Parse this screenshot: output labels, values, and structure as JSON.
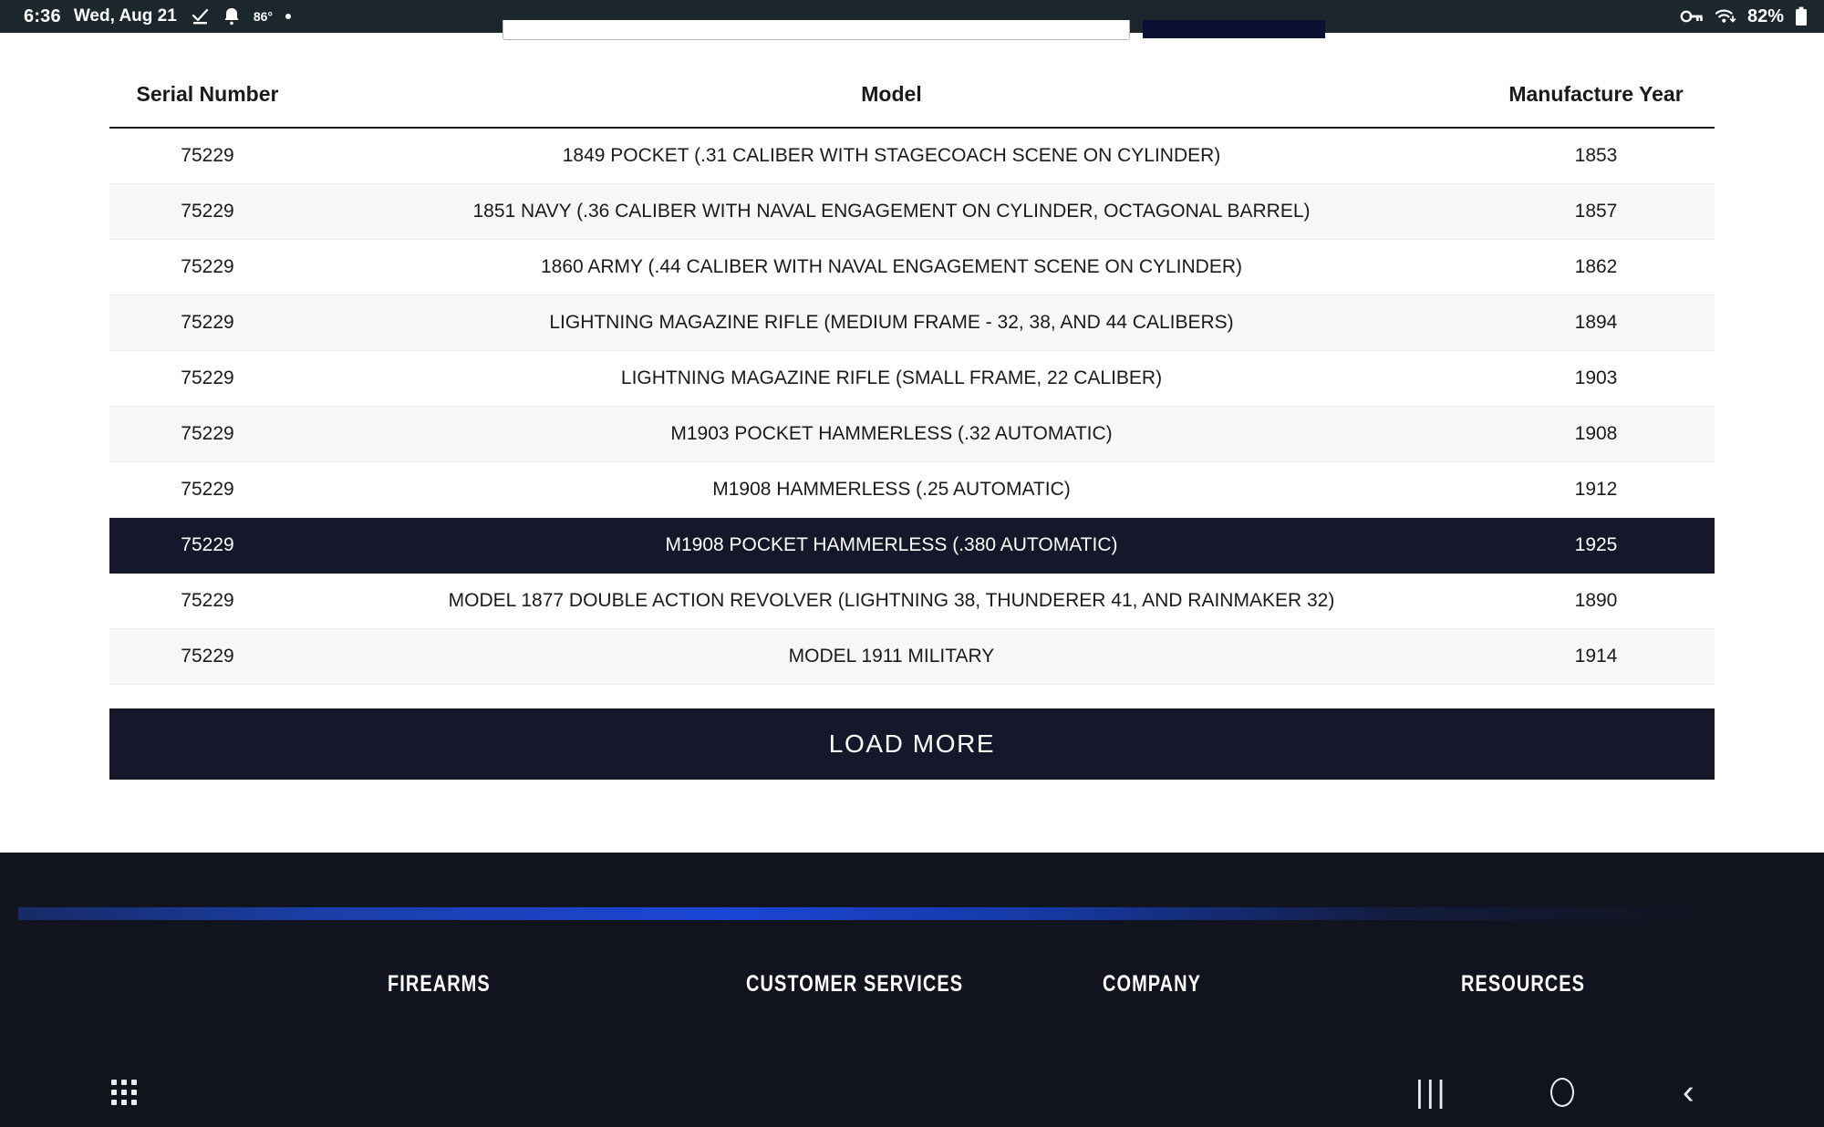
{
  "status_bar": {
    "time": "6:36",
    "date": "Wed, Aug 21",
    "temperature": "86",
    "degree": "°",
    "battery_percent": "82%",
    "icons": [
      "checkmark-underline-icon",
      "bell-icon",
      "vpn-key-icon",
      "wifi-icon",
      "battery-icon"
    ]
  },
  "table": {
    "columns": [
      "Serial Number",
      "Model",
      "Manufacture Year"
    ],
    "rows": [
      {
        "serial": "75229",
        "model": "1849 POCKET (.31 CALIBER WITH STAGECOACH SCENE ON CYLINDER)",
        "year": "1853"
      },
      {
        "serial": "75229",
        "model": "1851 NAVY (.36 CALIBER WITH NAVAL ENGAGEMENT ON CYLINDER, OCTAGONAL BARREL)",
        "year": "1857"
      },
      {
        "serial": "75229",
        "model": "1860 ARMY (.44 CALIBER WITH NAVAL ENGAGEMENT SCENE ON CYLINDER)",
        "year": "1862"
      },
      {
        "serial": "75229",
        "model": "LIGHTNING MAGAZINE RIFLE (MEDIUM FRAME - 32, 38, AND 44 CALIBERS)",
        "year": "1894"
      },
      {
        "serial": "75229",
        "model": "LIGHTNING MAGAZINE RIFLE (SMALL FRAME, 22 CALIBER)",
        "year": "1903"
      },
      {
        "serial": "75229",
        "model": "M1903 POCKET HAMMERLESS (.32 AUTOMATIC)",
        "year": "1908"
      },
      {
        "serial": "75229",
        "model": "M1908 HAMMERLESS (.25 AUTOMATIC)",
        "year": "1912"
      },
      {
        "serial": "75229",
        "model": "M1908 POCKET HAMMERLESS (.380 AUTOMATIC)",
        "year": "1925"
      },
      {
        "serial": "75229",
        "model": "MODEL 1877 DOUBLE ACTION REVOLVER (LIGHTNING 38, THUNDERER 41, AND RAINMAKER 32)",
        "year": "1890"
      },
      {
        "serial": "75229",
        "model": "MODEL 1911 MILITARY",
        "year": "1914"
      }
    ],
    "selected_row_index": 7
  },
  "load_more": {
    "label": "LOAD MORE"
  },
  "footer": {
    "columns": [
      "FIREARMS",
      "CUSTOMER SERVICES",
      "COMPANY",
      "RESOURCES"
    ],
    "accent_color": "#1b46d6",
    "background_color": "#11131f"
  },
  "nav_bar": {
    "icons": [
      "apps-grid-icon",
      "recents-icon",
      "home-icon",
      "back-icon"
    ]
  },
  "colors": {
    "selected_row": "#14182a",
    "alt_row": "#f7f7f7",
    "status_bar": "#1b262d"
  }
}
